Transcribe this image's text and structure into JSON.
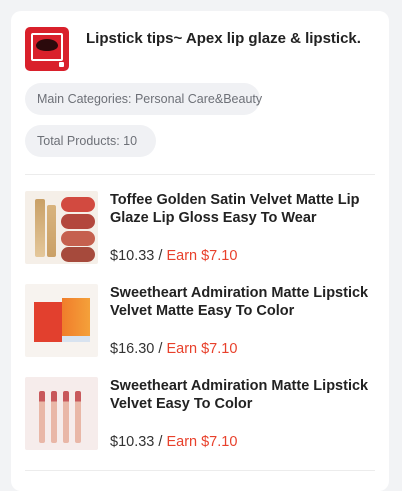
{
  "store": {
    "title": "Lipstick tips~ Apex lip glaze & lipstick.",
    "avatar_icon": "lips-logo-icon",
    "main_categories": "Main Categories: Personal Care&Beauty",
    "total_products": "Total Products: 10"
  },
  "products": [
    {
      "name": "Toffee Golden Satin Velvet Matte Lip Glaze Lip Gloss Easy To Wear",
      "price": "$10.33",
      "separator": " / ",
      "earn": "Earn $7.10"
    },
    {
      "name": "Sweetheart Admiration Matte Lipstick Velvet Matte Easy To Color",
      "price": "$16.30",
      "separator": " / ",
      "earn": "Earn $7.10"
    },
    {
      "name": "Sweetheart Admiration Matte Lipstick Velvet Easy To Color",
      "price": "$10.33",
      "separator": " / ",
      "earn": "Earn $7.10"
    }
  ],
  "colors": {
    "accent": "#e8412c",
    "pill_bg": "#f0f1f4",
    "page_bg": "#f2f3f5"
  }
}
